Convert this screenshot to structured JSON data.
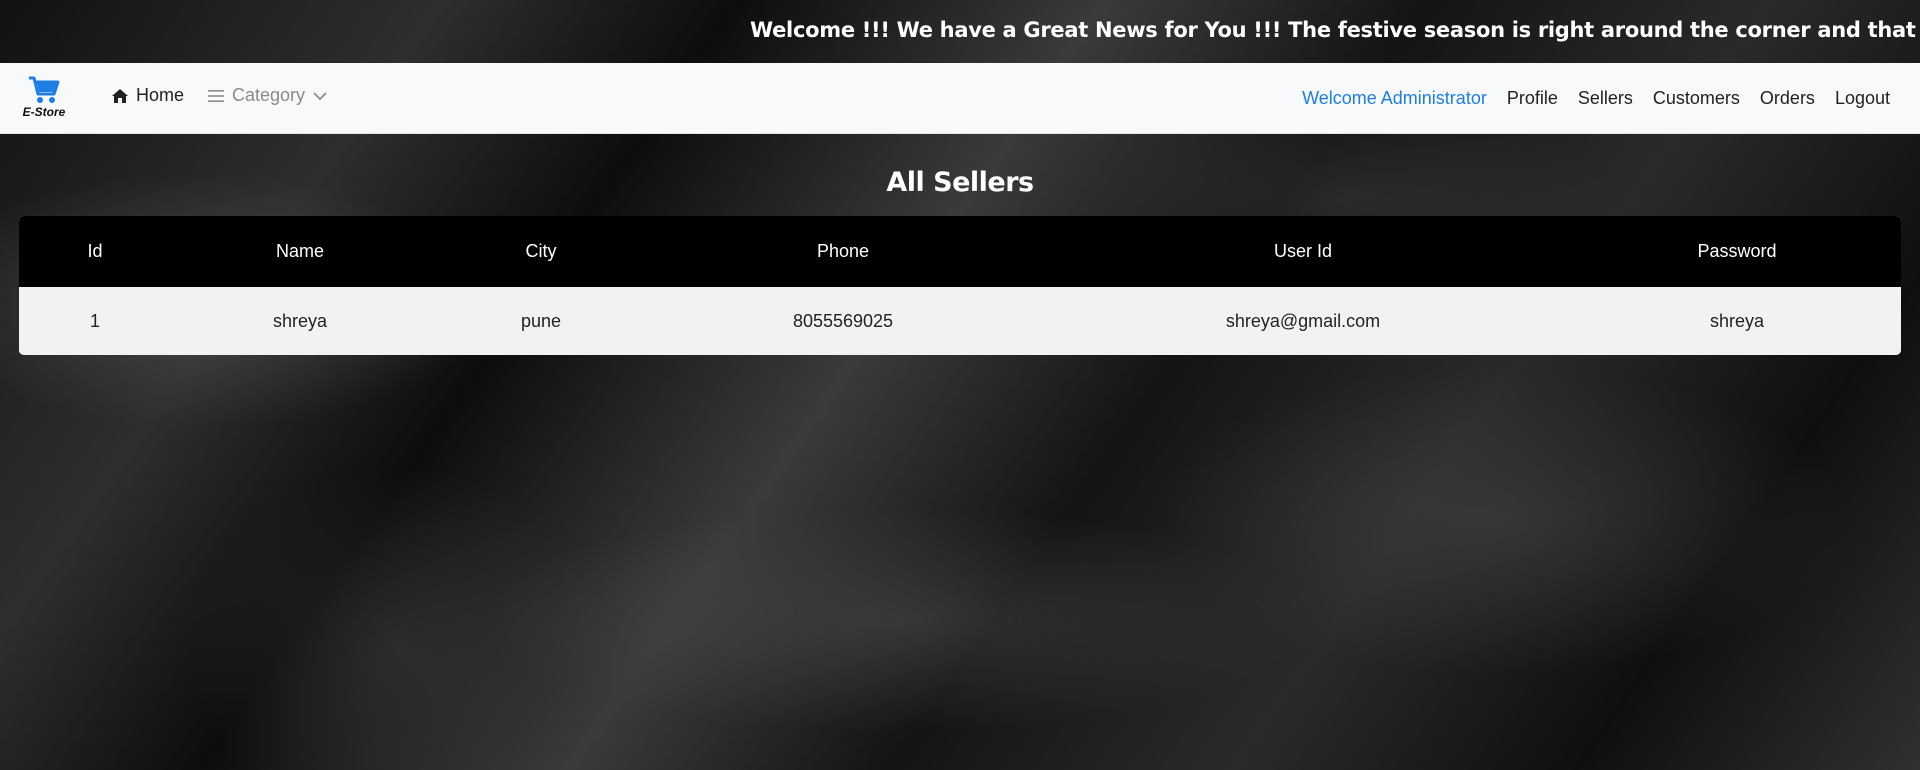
{
  "marquee": {
    "text": "Welcome !!! We have a Great News for You !!! The festive season is right around the corner and that can only mean c"
  },
  "navbar": {
    "brand": "E-Store",
    "brand_icon": "shopping-cart-icon",
    "brand_color": "#1e7ee6",
    "home": "Home",
    "home_icon": "home-icon",
    "category": "Category",
    "category_icon": "bars-icon",
    "welcome": "Welcome Administrator",
    "welcome_color": "#1e7ee6",
    "links": [
      "Profile",
      "Sellers",
      "Customers",
      "Orders",
      "Logout"
    ]
  },
  "main": {
    "title": "All Sellers",
    "columns": [
      "Id",
      "Name",
      "City",
      "Phone",
      "User Id",
      "Password"
    ],
    "rows": [
      [
        "1",
        "shreya",
        "pune",
        "8055569025",
        "shreya@gmail.com",
        "shreya"
      ]
    ]
  }
}
